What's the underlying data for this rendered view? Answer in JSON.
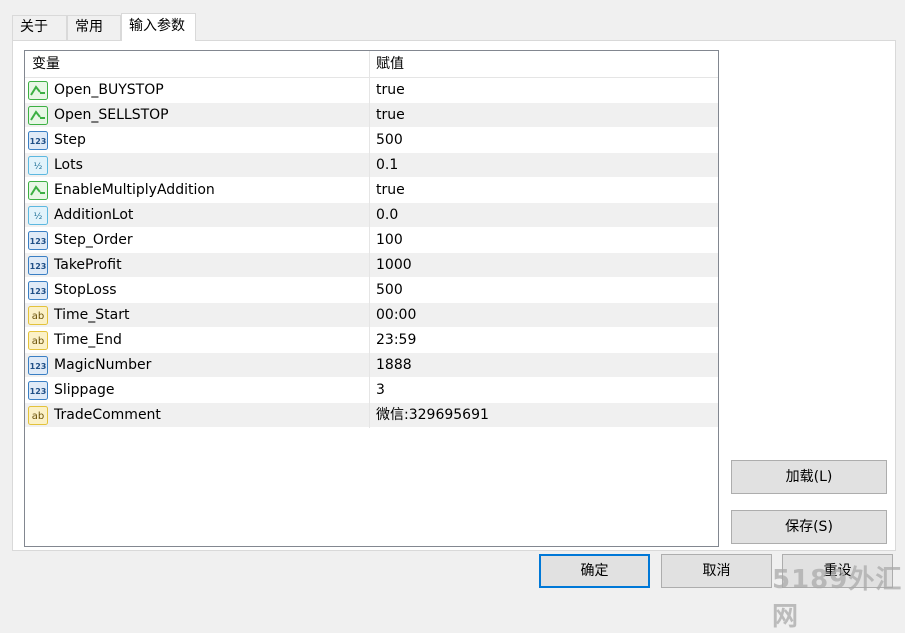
{
  "tabs": [
    "关于",
    "常用",
    "输入参数"
  ],
  "table": {
    "columns": [
      "变量",
      "赋值"
    ],
    "rows": [
      {
        "icon": "bool-icon",
        "name": "Open_BUYSTOP",
        "value": "true"
      },
      {
        "icon": "bool-icon",
        "name": "Open_SELLSTOP",
        "value": "true"
      },
      {
        "icon": "int-icon",
        "name": "Step",
        "value": "500"
      },
      {
        "icon": "double-icon",
        "name": "Lots",
        "value": "0.1"
      },
      {
        "icon": "bool-icon",
        "name": "EnableMultiplyAddition",
        "value": "true"
      },
      {
        "icon": "double-icon",
        "name": "AdditionLot",
        "value": "0.0"
      },
      {
        "icon": "int-icon",
        "name": "Step_Order",
        "value": "100"
      },
      {
        "icon": "int-icon",
        "name": "TakeProfit",
        "value": "1000"
      },
      {
        "icon": "int-icon",
        "name": "StopLoss",
        "value": "500"
      },
      {
        "icon": "string-icon",
        "name": "Time_Start",
        "value": "00:00"
      },
      {
        "icon": "string-icon",
        "name": "Time_End",
        "value": "23:59"
      },
      {
        "icon": "int-icon",
        "name": "MagicNumber",
        "value": "1888"
      },
      {
        "icon": "int-icon",
        "name": "Slippage",
        "value": "3"
      },
      {
        "icon": "string-icon",
        "name": "TradeComment",
        "value": "微信:329695691"
      }
    ]
  },
  "buttons": {
    "load": "加载(L)",
    "save": "保存(S)",
    "ok": "确定",
    "cancel": "取消",
    "reset": "重设"
  },
  "watermark": "5189外汇网",
  "colors": {
    "bool_icon": "#3cb043",
    "int_icon": "#3a7fc4",
    "double_icon": "#5cb8e0",
    "string_icon": "#e3c23b",
    "default_button_border": "#0078d7"
  }
}
